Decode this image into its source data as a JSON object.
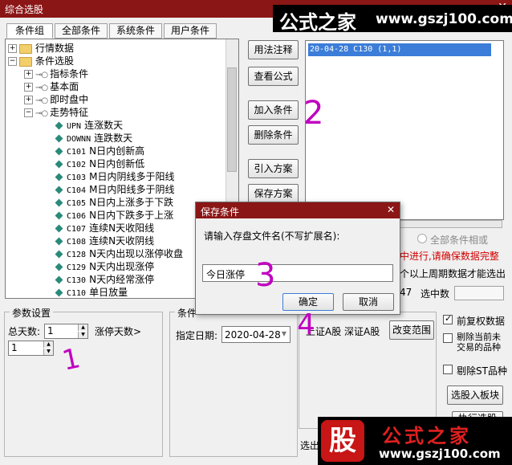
{
  "window": {
    "title": "综合选股",
    "close": "✕"
  },
  "watermark_top": {
    "cn": "公式之家",
    "url": "www.gszj100.com"
  },
  "tabs": [
    "条件组",
    "全部条件",
    "系统条件",
    "用户条件"
  ],
  "tree": {
    "top": [
      {
        "pm": "+",
        "label": "行情数据"
      },
      {
        "pm": "−",
        "label": "条件选股"
      }
    ],
    "sub": [
      {
        "pm": "+",
        "label": "指标条件"
      },
      {
        "pm": "+",
        "label": "基本面"
      },
      {
        "pm": "+",
        "label": "即时盘中"
      },
      {
        "pm": "−",
        "label": "走势特征"
      }
    ],
    "leaves": [
      {
        "code": "UPN",
        "name": "连涨数天"
      },
      {
        "code": "DOWNN",
        "name": "连跌数天"
      },
      {
        "code": "C101",
        "name": "N日内创新高"
      },
      {
        "code": "C102",
        "name": "N日内创新低"
      },
      {
        "code": "C103",
        "name": "M日内阴线多于阳线"
      },
      {
        "code": "C104",
        "name": "M日内阳线多于阴线"
      },
      {
        "code": "C105",
        "name": "N日内上涨多于下跌"
      },
      {
        "code": "C106",
        "name": "N日内下跌多于上涨"
      },
      {
        "code": "C107",
        "name": "连续N天收阳线"
      },
      {
        "code": "C108",
        "name": "连续N天收阴线"
      },
      {
        "code": "C128",
        "name": "N天内出现以涨停收盘"
      },
      {
        "code": "C129",
        "name": "N天内出现涨停"
      },
      {
        "code": "C130",
        "name": "N天内经常涨停"
      },
      {
        "code": "C110",
        "name": "单日放量"
      }
    ]
  },
  "buttons": {
    "usage": "用法注释",
    "view_formula": "查看公式",
    "add_condition": "加入条件",
    "delete_condition": "删除条件",
    "import_plan": "引入方案",
    "save_plan": "保存方案",
    "change_range": "改变范围",
    "select_to_block": "选股入板块",
    "exec_partial": "执行选股"
  },
  "result": {
    "item": "20-04-28 C130 (1,1)"
  },
  "right_info": {
    "all_cond": "全部条件相或",
    "warn": "中进行,请确保数据完整",
    "note": "个以上周期数据才能选出",
    "count_value": "47",
    "selected_label": "选中数"
  },
  "params": {
    "legend": "参数设置",
    "total_days_label": "总天数:",
    "total_days_value": "1",
    "limit_days_label": "涨停天数>",
    "limit_days_value": "1"
  },
  "cond": {
    "legend": "条件",
    "date_label": "指定日期:",
    "date_value": "2020-04-28"
  },
  "range": {
    "markets": "上证A股  深证A股",
    "pre_fq": "前复权数据",
    "exclude_stop": "剔除当前未交易的品种",
    "exclude_st": "剔除ST品种"
  },
  "bottom": {
    "select_label": "选出"
  },
  "dialog": {
    "title": "保存条件",
    "prompt": "请输入存盘文件名(不写扩展名):",
    "input_value": "今日涨停",
    "ok": "确定",
    "cancel": "取消",
    "close": "✕"
  },
  "annotations": {
    "a1": "1",
    "a2": "2",
    "a3": "3",
    "a4": "4"
  },
  "watermark_bottom": {
    "logo": "股",
    "cn": "公式之家",
    "url": "www.gszj100.com"
  }
}
